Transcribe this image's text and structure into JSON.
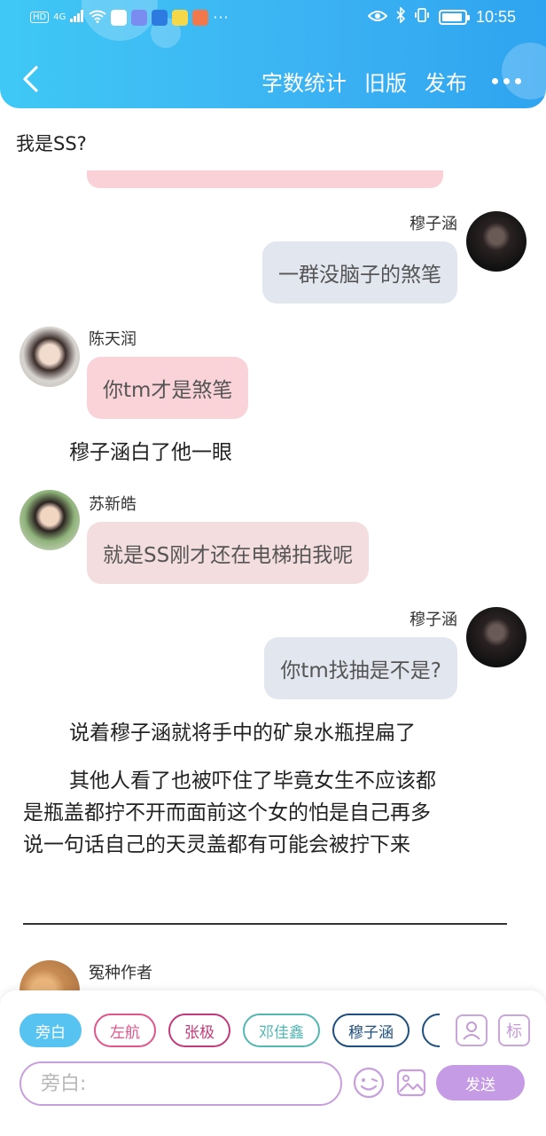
{
  "status_bar": {
    "left_labels": [
      "HD",
      "4G"
    ],
    "time": "10:55"
  },
  "navbar": {
    "word_count": "字数统计",
    "old_version": "旧版",
    "publish": "发布"
  },
  "content": {
    "top_text": "我是SS?",
    "messages": [
      {
        "name": "穆子涵",
        "text": "一群没脑子的煞笔"
      },
      {
        "name": "陈天润",
        "text": "你tm才是煞笔"
      },
      {
        "narration": "穆子涵白了他一眼"
      },
      {
        "name": "苏新皓",
        "text": "就是SS刚才还在电梯拍我呢"
      },
      {
        "name": "穆子涵",
        "text": "你tm找抽是不是?"
      },
      {
        "narration": "说着穆子涵就将手中的矿泉水瓶捏扁了"
      },
      {
        "narration_lines": [
          "其他人看了也被吓住了毕竟女生不应该都",
          "是瓶盖都拧不开而面前这个女的怕是自己再多",
          "说一句话自己的天灵盖都有可能会被拧下来"
        ]
      }
    ],
    "last_name": "冤种作者"
  },
  "roles": [
    {
      "label": "旁白",
      "color": "#56c3f0",
      "active": true
    },
    {
      "label": "左航",
      "color": "#e0568b"
    },
    {
      "label": "张极",
      "color": "#c23a7a"
    },
    {
      "label": "邓佳鑫",
      "color": "#53b8b3"
    },
    {
      "label": "穆子涵",
      "color": "#1f4f7e"
    }
  ],
  "tools": {
    "tag_label": "标"
  },
  "input": {
    "placeholder": "旁白:",
    "send_label": "发送"
  }
}
